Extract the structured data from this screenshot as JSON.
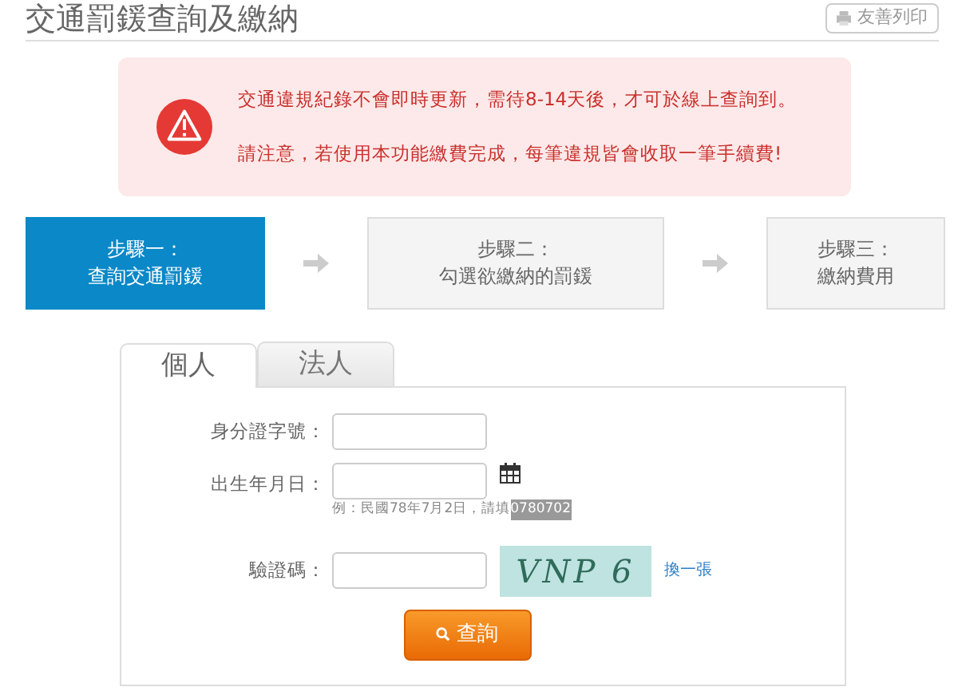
{
  "page_title": "交通罰鍰查詢及繳納",
  "print_button": "友善列印",
  "alert": {
    "lines": [
      "交通違規紀錄不會即時更新，需待8-14天後，才可於線上查詢到。",
      "請注意，若使用本功能繳費完成，每筆違規皆會收取一筆手續費!"
    ]
  },
  "steps": [
    {
      "title": "步驟一：",
      "label": "查詢交通罰鍰",
      "selected": true
    },
    {
      "title": "步驟二：",
      "label": "勾選欲繳納的罰鍰",
      "selected": false
    },
    {
      "title": "步驟三：",
      "label": "繳納費用",
      "selected": false
    }
  ],
  "tabs": [
    {
      "label": "個人",
      "selected": true
    },
    {
      "label": "法人",
      "selected": false
    }
  ],
  "form": {
    "id_label": "身分證字號：",
    "birth_label": "出生年月日：",
    "hint": {
      "text": "例：民國78年7月2日，請填",
      "highlight": "0780702"
    },
    "captcha_label": "驗證碼：",
    "captcha_text": "VNP 6",
    "refresh_link": "換一張",
    "submit": "查詢"
  }
}
